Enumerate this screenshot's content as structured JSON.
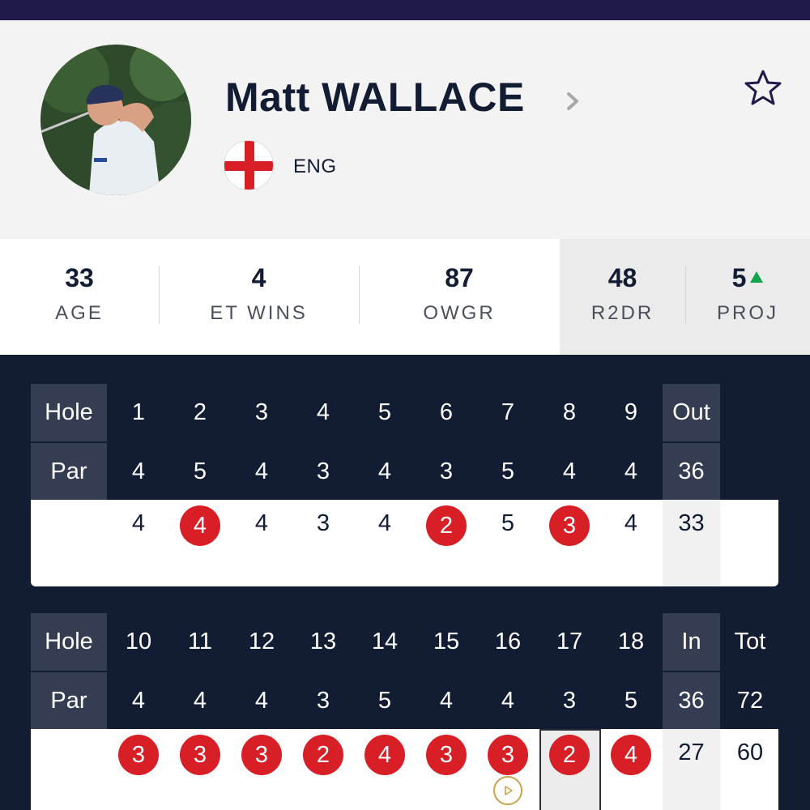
{
  "player": {
    "name": "Matt WALLACE",
    "country": "ENG"
  },
  "stats": [
    {
      "value": "33",
      "label": "AGE"
    },
    {
      "value": "4",
      "label": "ET WINS"
    },
    {
      "value": "87",
      "label": "OWGR"
    },
    {
      "value": "48",
      "label": "R2DR"
    },
    {
      "value": "5",
      "label": "PROJ",
      "trend": "up"
    }
  ],
  "colors": {
    "navy": "#121c33",
    "birdie_red": "#d81f26",
    "trend_green": "#13a34a",
    "header_cell": "#353d52"
  },
  "front_nine": {
    "hole_label": "Hole",
    "par_label": "Par",
    "holes": [
      "1",
      "2",
      "3",
      "4",
      "5",
      "6",
      "7",
      "8",
      "9"
    ],
    "pars": [
      "4",
      "5",
      "4",
      "3",
      "4",
      "3",
      "5",
      "4",
      "4"
    ],
    "scores": [
      "4",
      "4",
      "4",
      "3",
      "4",
      "2",
      "5",
      "3",
      "4"
    ],
    "birdies": [
      false,
      true,
      false,
      false,
      false,
      true,
      false,
      true,
      false
    ],
    "sum_label": "Out",
    "sum_par": "36",
    "sum_score": "33"
  },
  "back_nine": {
    "hole_label": "Hole",
    "par_label": "Par",
    "holes": [
      "10",
      "11",
      "12",
      "13",
      "14",
      "15",
      "16",
      "17",
      "18"
    ],
    "pars": [
      "4",
      "4",
      "4",
      "3",
      "5",
      "4",
      "4",
      "3",
      "5"
    ],
    "scores": [
      "3",
      "3",
      "3",
      "2",
      "4",
      "3",
      "3",
      "2",
      "4"
    ],
    "birdies": [
      true,
      true,
      true,
      true,
      true,
      true,
      true,
      true,
      true
    ],
    "sum_label": "In",
    "sum_par": "36",
    "sum_score": "27",
    "total_label": "Tot",
    "total_par": "72",
    "total_score": "60"
  }
}
